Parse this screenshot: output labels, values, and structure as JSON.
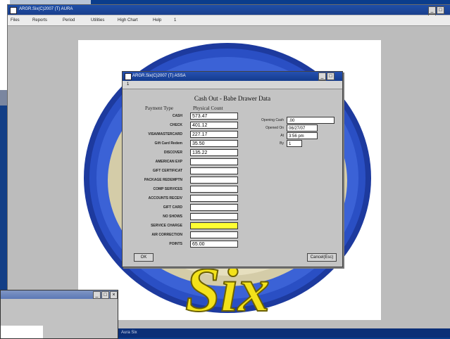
{
  "main_window": {
    "title": "ARGR.Six(C)2007 (T) AURA",
    "menu": [
      "Files",
      "Reports",
      "Period",
      "Utilities",
      "High Chart",
      "Help",
      "1"
    ],
    "controls": [
      "_",
      "□",
      "×"
    ]
  },
  "dialog": {
    "title": "ARGR.Six(C)2007 (T) ASSA",
    "menu_label": "1",
    "controls": [
      "_",
      "□",
      "×"
    ],
    "heading": "Cash Out - Babe Drawer Data",
    "col_payment_type": "Payment Type",
    "col_physical_count": "Physical Count",
    "rows": [
      {
        "label": "CASH",
        "value": "573.47"
      },
      {
        "label": "CHECK",
        "value": "401.12"
      },
      {
        "label": "VISA/MASTERCARD",
        "value": "227.17"
      },
      {
        "label": "Gift Card Redem",
        "value": "35.50"
      },
      {
        "label": "DISCOVER",
        "value": "135.22"
      },
      {
        "label": "AMERICAN EXP",
        "value": ""
      },
      {
        "label": "GIFT CERTIFICAT",
        "value": ""
      },
      {
        "label": "PACKAGE REDEMPTN",
        "value": ""
      },
      {
        "label": "COMP SERVICES",
        "value": ""
      },
      {
        "label": "ACCOUNTS RECEIV",
        "value": ""
      },
      {
        "label": "GIFT CARD",
        "value": ""
      },
      {
        "label": "NO SHOWS",
        "value": ""
      },
      {
        "label": "SERVICE CHARGE",
        "value": ""
      },
      {
        "label": "AIR CORRECTION",
        "value": ""
      },
      {
        "label": "POINTS",
        "value": "65.00"
      }
    ],
    "side": {
      "opening_cash_label": "Opening Cash",
      "opening_cash_value": ".00",
      "opened_on_label": "Opened On",
      "opened_on_value": "06/27/07",
      "at_label": "At",
      "at_value": "3:56 pm",
      "by_label": "By",
      "by_value": "1"
    },
    "ok_button": "OK",
    "cancel_button": "Cancel(Esc)"
  },
  "bottom_window": {
    "controls": [
      "_",
      "□",
      "×"
    ]
  },
  "taskbar": {
    "text": "Aura Six"
  }
}
